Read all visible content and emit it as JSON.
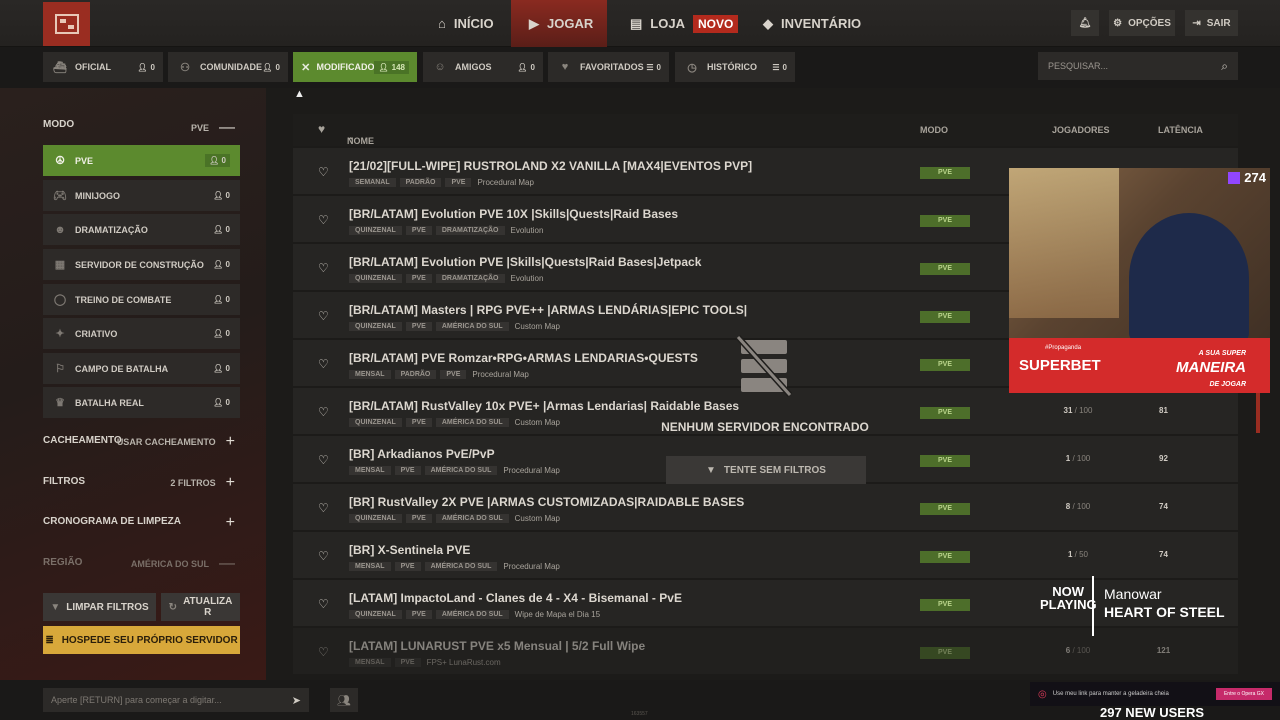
{
  "topnav": {
    "tabs": [
      {
        "label": "INÍCIO",
        "icon": "home-icon"
      },
      {
        "label": "JOGAR",
        "icon": "play-icon",
        "active": true
      },
      {
        "label": "LOJA",
        "icon": "store-icon",
        "badge": "NOVO"
      },
      {
        "label": "INVENTÁRIO",
        "icon": "box-icon"
      }
    ],
    "options_label": "OPÇÕES",
    "exit_label": "SAIR"
  },
  "filter_tabs": [
    {
      "label": "OFICIAL",
      "count": "0"
    },
    {
      "label": "COMUNIDADE",
      "count": "0"
    },
    {
      "label": "MODIFICADO",
      "count": "148",
      "active": true
    },
    {
      "label": "AMIGOS",
      "count": "0"
    },
    {
      "label": "FAVORITADOS",
      "count": "0"
    },
    {
      "label": "HISTÓRICO",
      "count": "0"
    }
  ],
  "search": {
    "placeholder": "PESQUISAR..."
  },
  "sidebar": {
    "mode_label": "MODO",
    "mode_value": "PVE",
    "modes": [
      {
        "label": "PVE",
        "count": "0",
        "active": true
      },
      {
        "label": "MINIJOGO",
        "count": "0"
      },
      {
        "label": "DRAMATIZAÇÃO",
        "count": "0"
      },
      {
        "label": "SERVIDOR DE CONSTRUÇÃO",
        "count": "0"
      },
      {
        "label": "TREINO DE COMBATE",
        "count": "0"
      },
      {
        "label": "CRIATIVO",
        "count": "0"
      },
      {
        "label": "CAMPO DE BATALHA",
        "count": "0"
      },
      {
        "label": "BATALHA REAL",
        "count": "0"
      }
    ],
    "cache_label": "CACHEAMENTO",
    "cache_value": "USAR CACHEAMENTO",
    "filters_label": "FILTROS",
    "filters_value": "2 FILTROS",
    "wipe_label": "CRONOGRAMA DE LIMPEZA",
    "region_label": "REGIÃO",
    "region_value": "AMÉRICA DO SUL",
    "clear_label": "LIMPAR FILTROS",
    "refresh_label_1": "ATUALIZA",
    "refresh_label_2": "R",
    "host_label": "HOSPEDE SEU PRÓPRIO SERVIDOR"
  },
  "table": {
    "col_name": "NOME",
    "col_mode": "MODO",
    "col_players": "JOGADORES",
    "col_latency": "LATÊNCIA",
    "rows": [
      {
        "name": "[21/02][FULL-WIPE] RUSTROLAND X2 VANILLA [MAX4|EVENTOS PVP]",
        "tags": [
          "SEMANAL",
          "PADRÃO",
          "PVE"
        ],
        "extra": "Procedural Map",
        "mode": "PVE",
        "players": "",
        "max": "",
        "latency": ""
      },
      {
        "name": "[BR/LATAM] Evolution PVE 10X |Skills|Quests|Raid Bases",
        "tags": [
          "QUINZENAL",
          "PVE",
          "DRAMATIZAÇÃO"
        ],
        "extra": "Evolution",
        "mode": "PVE",
        "players": "",
        "max": "",
        "latency": ""
      },
      {
        "name": "[BR/LATAM] Evolution PVE |Skills|Quests|Raid Bases|Jetpack",
        "tags": [
          "QUINZENAL",
          "PVE",
          "DRAMATIZAÇÃO"
        ],
        "extra": "Evolution",
        "mode": "PVE",
        "players": "",
        "max": "",
        "latency": ""
      },
      {
        "name": "[BR/LATAM] Masters | RPG PVE++ |ARMAS LENDÁRIAS|EPIC TOOLS|",
        "tags": [
          "QUINZENAL",
          "PVE",
          "AMÉRICA DO SUL"
        ],
        "extra": "Custom Map",
        "mode": "PVE",
        "players": "",
        "max": "",
        "latency": ""
      },
      {
        "name": "[BR/LATAM] PVE Romzar•RPG•ARMAS LENDARIAS•QUESTS",
        "tags": [
          "MENSAL",
          "PADRÃO",
          "PVE"
        ],
        "extra": "Procedural Map",
        "mode": "PVE",
        "players": "",
        "max": "",
        "latency": ""
      },
      {
        "name": "[BR/LATAM] RustValley 10x PVE+ |Armas Lendarias| Raidable Bases",
        "tags": [
          "QUINZENAL",
          "PVE",
          "AMÉRICA DO SUL"
        ],
        "extra": "Custom Map",
        "mode": "PVE",
        "players": "31",
        "max": " / 100",
        "latency": "81"
      },
      {
        "name": "[BR] Arkadianos PvE/PvP",
        "tags": [
          "MENSAL",
          "PVE",
          "AMÉRICA DO SUL"
        ],
        "extra": "Procedural Map",
        "mode": "PVE",
        "players": "1",
        "max": " / 100",
        "latency": "92"
      },
      {
        "name": "[BR] RustValley 2X PVE |ARMAS CUSTOMIZADAS|RAIDABLE BASES",
        "tags": [
          "QUINZENAL",
          "PVE",
          "AMÉRICA DO SUL"
        ],
        "extra": "Custom Map",
        "mode": "PVE",
        "players": "8",
        "max": " / 100",
        "latency": "74"
      },
      {
        "name": "[BR] X-Sentinela PVE",
        "tags": [
          "MENSAL",
          "PVE",
          "AMÉRICA DO SUL"
        ],
        "extra": "Procedural Map",
        "mode": "PVE",
        "players": "1",
        "max": " / 50",
        "latency": "74"
      },
      {
        "name": "[LATAM] ImpactoLand - Clanes de 4 - X4 - Bisemanal - PvE",
        "tags": [
          "QUINZENAL",
          "PVE",
          "AMÉRICA DO SUL"
        ],
        "extra": "Wipe de Mapa el Dia 15",
        "mode": "PVE",
        "players": "",
        "max": "",
        "latency": ""
      },
      {
        "name": "[LATAM] LUNARUST PVE x5 Mensual | 5/2 Full Wipe",
        "tags": [
          "MENSAL",
          "PVE"
        ],
        "extra": "FPS+ LunaRust.com",
        "mode": "PVE",
        "players": "6",
        "max": " / 100",
        "latency": "121"
      }
    ]
  },
  "empty_state": {
    "text": "NENHUM SERVIDOR ENCONTRADO",
    "button": "TENTE SEM FILTROS"
  },
  "stream": {
    "viewers": "274",
    "ad_brand": "SUPERBET",
    "ad_small": "#Propaganda",
    "ad_slogan_1": "A SUA SUPER",
    "ad_slogan_2": "MANEIRA",
    "ad_slogan_3": "DE JOGAR",
    "now_playing_1": "NOW",
    "now_playing_2": "PLAYING",
    "artist": "Manowar",
    "song": "HEART OF STEEL",
    "promo_text": "Use meu link para manter a geladeira cheia",
    "promo_button": "Entre o Opera GX",
    "new_users": "297 NEW USERS"
  },
  "chat": {
    "placeholder": "Aperte [RETURN] para começar a digitar..."
  },
  "build": "163557"
}
